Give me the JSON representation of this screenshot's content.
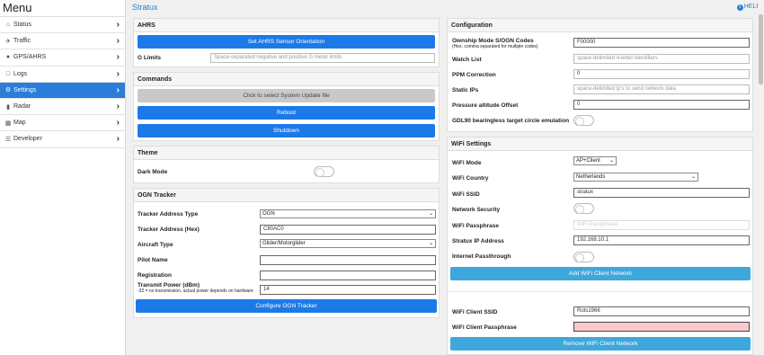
{
  "sidebar": {
    "title": "Menu",
    "items": [
      {
        "icon": "home",
        "label": "Status"
      },
      {
        "icon": "plane",
        "label": "Traffic"
      },
      {
        "icon": "globe",
        "label": "GPS/AHRS"
      },
      {
        "icon": "file",
        "label": "Logs"
      },
      {
        "icon": "gear",
        "label": "Settings"
      },
      {
        "icon": "signal",
        "label": "Radar"
      },
      {
        "icon": "map",
        "label": "Map"
      },
      {
        "icon": "list",
        "label": "Developer"
      }
    ],
    "active_index": 4
  },
  "header": {
    "title": "Stratux",
    "help": "HELP"
  },
  "ahrs": {
    "title": "AHRS",
    "set_orientation": "Set AHRS Sensor Orientation",
    "g_limits_label": "G Limits",
    "g_limits_placeholder": "Space-separated negative and positive G meter limits"
  },
  "commands": {
    "title": "Commands",
    "update": "Click to select System Update file",
    "reboot": "Reboot",
    "shutdown": "Shutdown"
  },
  "theme": {
    "title": "Theme",
    "dark_mode": "Dark Mode"
  },
  "ogn": {
    "title": "OGN Tracker",
    "address_type_label": "Tracker Address Type",
    "address_type_value": "OGN",
    "address_hex_label": "Tracker Address (Hex)",
    "address_hex_value": "C80AC0",
    "aircraft_type_label": "Aircraft Type",
    "aircraft_type_value": "Glider/Motorglider",
    "pilot_label": "Pilot Name",
    "registration_label": "Registration",
    "tx_power_label": "Transmit Power (dBm)",
    "tx_power_sub": "-32 = no transmission, actual power depends on hardware",
    "tx_power_value": "14",
    "configure": "Configure OGN Tracker"
  },
  "configuration": {
    "title": "Configuration",
    "ownship_label": "Ownship Mode S/OGN Codes",
    "ownship_sub": "(Hex, comma separated for multiple codes)",
    "ownship_value": "F00000",
    "watchlist_label": "Watch List",
    "watchlist_placeholder": "space-delimited 4-letter identifiers",
    "ppm_label": "PPM Correction",
    "ppm_value": "0",
    "static_ips_label": "Static IPs",
    "static_ips_placeholder": "space-delimited ip's to send network data",
    "pressure_label": "Pressure altitude Offset",
    "pressure_value": "0",
    "gdl90_label": "GDL90 bearingless target circle emulation"
  },
  "wifi": {
    "title": "WiFi Settings",
    "mode_label": "WiFi Mode",
    "mode_value": "AP+Client",
    "country_label": "WiFi Country",
    "country_value": "Netherlands",
    "ssid_label": "WiFi SSID",
    "ssid_value": "stratux",
    "security_label": "Network Security",
    "passphrase_label": "WiFi Passphrase",
    "passphrase_placeholder": "WiFi Passphrase",
    "ip_label": "Stratux IP Address",
    "ip_value": "192.168.10.1",
    "passthrough_label": "Internet Passthrough",
    "add_client": "Add WiFi Client Network",
    "client_ssid_label": "WiFi Client SSID",
    "client_ssid_value": "Rots1966",
    "client_pass_label": "WiFi Client Passphrase",
    "client_pass_value": "",
    "remove_client": "Remove WiFi Client Network"
  }
}
